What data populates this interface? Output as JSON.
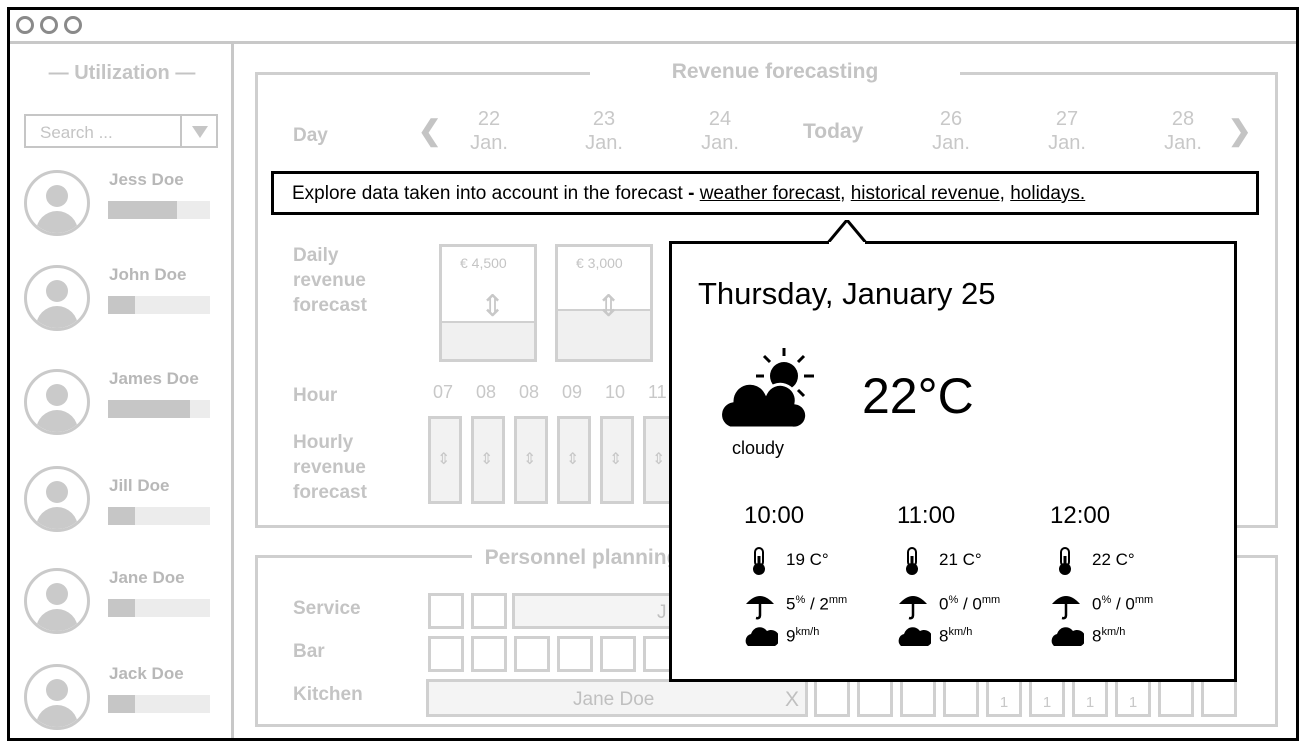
{
  "sidebar": {
    "title": "— Utilization —",
    "search_placeholder": "Search ...",
    "users": [
      {
        "name": "Jess Doe",
        "utilization": 0.68
      },
      {
        "name": "John Doe",
        "utilization": 0.26
      },
      {
        "name": "James Doe",
        "utilization": 0.8
      },
      {
        "name": "Jill Doe",
        "utilization": 0.26
      },
      {
        "name": "Jane Doe",
        "utilization": 0.26
      },
      {
        "name": "Jack Doe",
        "utilization": 0.26
      }
    ]
  },
  "forecast": {
    "title": "Revenue forecasting",
    "day_label": "Day",
    "days": [
      {
        "num": "22",
        "mon": "Jan."
      },
      {
        "num": "23",
        "mon": "Jan."
      },
      {
        "num": "24",
        "mon": "Jan."
      },
      {
        "num": "26",
        "mon": "Jan."
      },
      {
        "num": "27",
        "mon": "Jan."
      },
      {
        "num": "28",
        "mon": "Jan."
      }
    ],
    "today_label": "Today",
    "explore_text": "Explore data taken into account in the forecast",
    "explore_sep": " - ",
    "explore_links": [
      "weather forecast",
      "historical revenue",
      "holidays."
    ],
    "daily_label": "Daily revenue forecast",
    "daily_values": [
      "€ 4,500",
      "€ 3,000"
    ],
    "hour_label": "Hour",
    "hours": [
      "07",
      "08",
      "08",
      "09",
      "10",
      "11"
    ],
    "hourly_label": "Hourly revenue forecast"
  },
  "personnel": {
    "title": "Personnel planning",
    "rows": [
      "Service",
      "Bar",
      "Kitchen"
    ],
    "service_name": "J",
    "kitchen_name": "Jane Doe",
    "kitchen_remove": "X",
    "kitchen_counts": [
      "1",
      "1",
      "1",
      "1"
    ]
  },
  "weather": {
    "date": "Thursday, January 25",
    "temp": "22°C",
    "condition": "cloudy",
    "slots": [
      {
        "time": "10:00",
        "temp": "19 C°",
        "rain_pct": "5",
        "rain_mm": "2",
        "wind": "9"
      },
      {
        "time": "11:00",
        "temp": "21 C°",
        "rain_pct": "0",
        "rain_mm": "0",
        "wind": "8"
      },
      {
        "time": "12:00",
        "temp": "22 C°",
        "rain_pct": "0",
        "rain_mm": "0",
        "wind": "8"
      }
    ],
    "pct_unit": "%",
    "mm_unit": "mm",
    "sep": " / ",
    "wind_unit": "km/h"
  }
}
